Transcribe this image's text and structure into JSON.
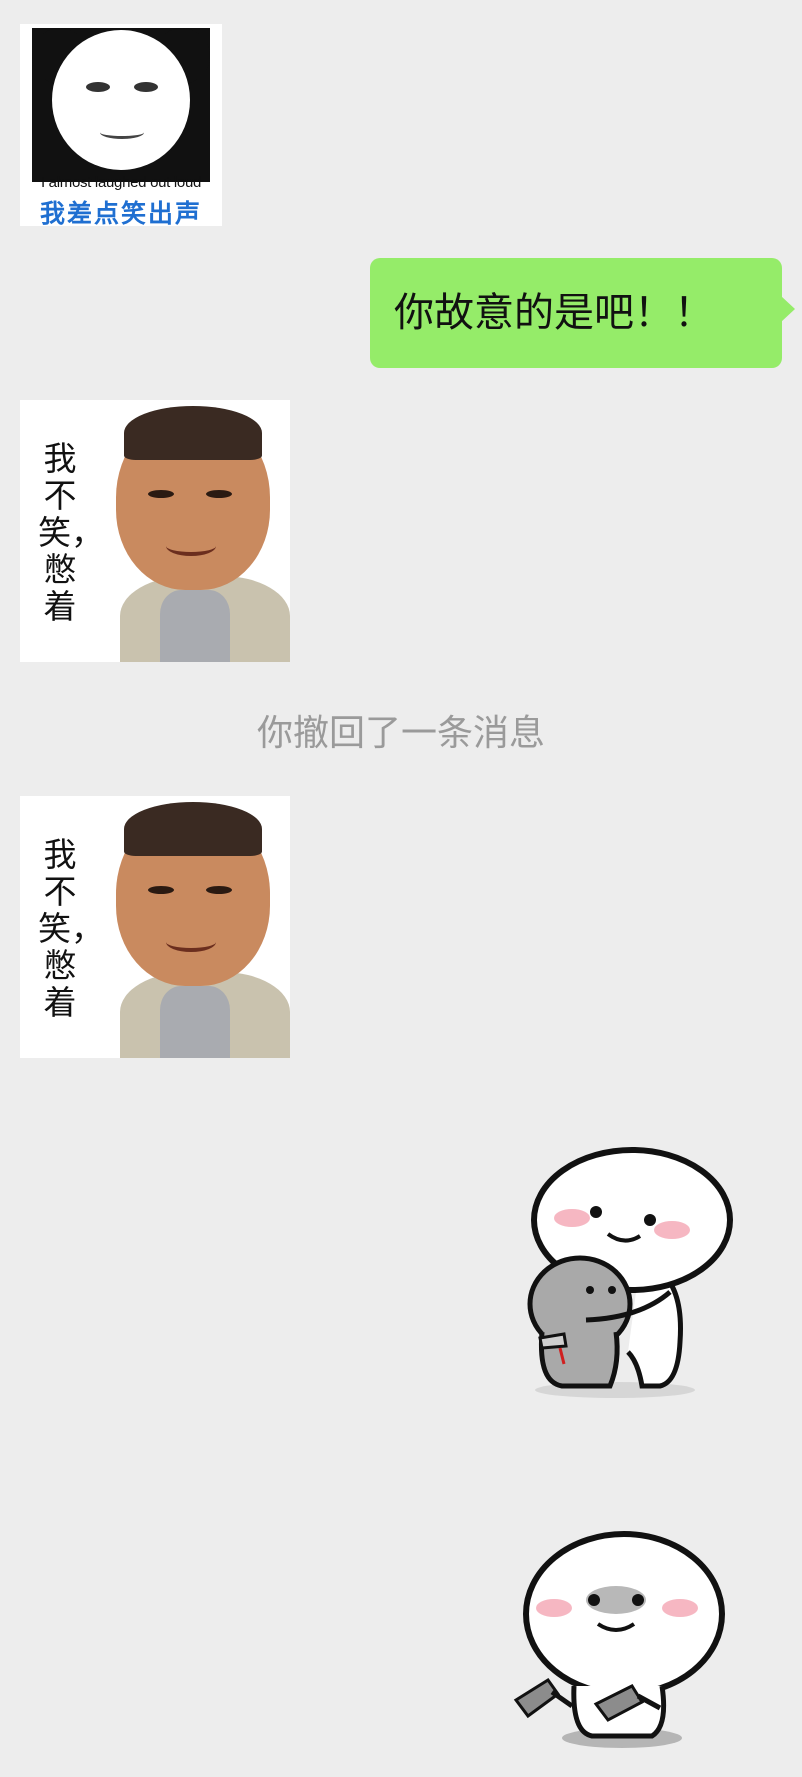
{
  "messages": {
    "panda_sticker": {
      "caption_en": "I almost laughed out loud",
      "caption_zh": "我差点笑出声"
    },
    "outgoing_text": "你故意的是吧！！",
    "man_sticker_1": {
      "caption": "我不笑，憋着"
    },
    "recall_notice": "你撤回了一条消息",
    "man_sticker_2": {
      "caption": "我不笑，憋着"
    }
  },
  "colors": {
    "background": "#ededed",
    "outgoing_bubble": "#95ec69",
    "recall_text": "#9a9a9a",
    "panda_caption_zh": "#1f6fd1"
  }
}
